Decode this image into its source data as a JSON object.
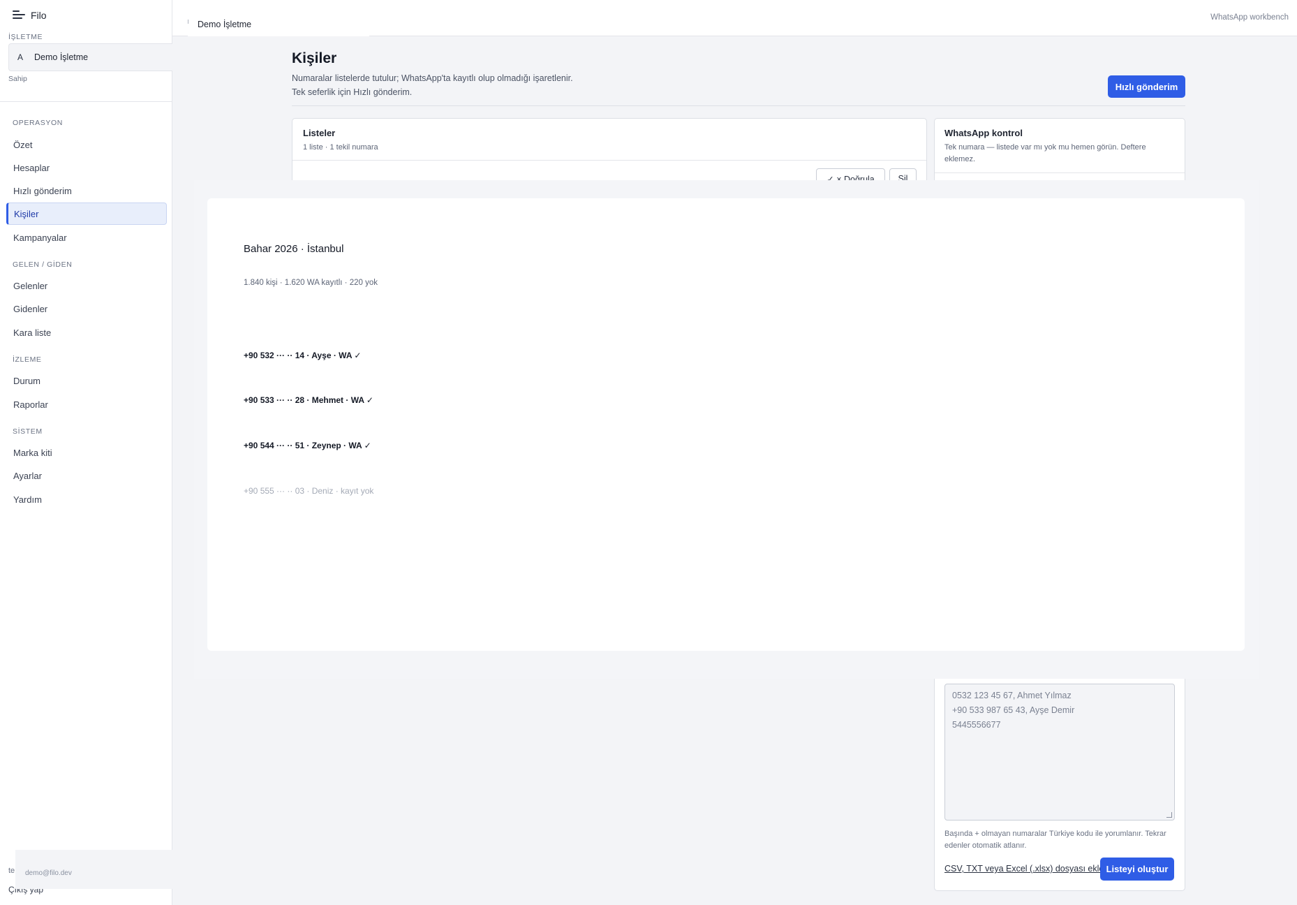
{
  "sidebar": {
    "brand": "Filo",
    "business_section": "İŞLETME",
    "business_avatar": "A",
    "business_name": "Demo İşletme",
    "role": "Sahip",
    "groups": [
      {
        "label": "OPERASYON",
        "items": [
          "Özet",
          "Hesaplar",
          "Hızlı gönderim",
          "Kişiler",
          "Kampanyalar"
        ]
      },
      {
        "label": "GELEN / GİDEN",
        "items": [
          "Gelenler",
          "Gidenler",
          "Kara liste"
        ]
      },
      {
        "label": "İZLEME",
        "items": [
          "Durum",
          "Raporlar"
        ]
      },
      {
        "label": "SİSTEM",
        "items": [
          "Marka kiti",
          "Ayarlar",
          "Yardım"
        ]
      }
    ],
    "active_item": "Kişiler",
    "user_email": "demo@filo.dev",
    "user_prefix": "te",
    "logout": "Çıkış yap"
  },
  "topbar": {
    "tab": "Demo İşletme",
    "workbench": "WhatsApp workbench"
  },
  "page": {
    "title": "Kişiler",
    "subtitle_1": "Numaralar listelerde tutulur; WhatsApp'ta kayıtlı olup olmadığı işaretlenir.",
    "subtitle_2": "Tek seferlik için Hızlı gönderim.",
    "quick_send": "Hızlı gönderim"
  },
  "lists_card": {
    "title": "Listeler",
    "meta": "1 liste · 1 tekil numara",
    "verify_button": "✓ × Doğrula",
    "delete_button": "Sil"
  },
  "wa_card": {
    "title": "WhatsApp kontrol",
    "meta": "Tek numara — listede var mı yok mu hemen görün. Deftere eklemez."
  },
  "modal": {
    "title": "Bahar 2026 · İstanbul",
    "stats": "1.840 kişi · 1.620 WA kayıtlı · 220 yok",
    "rows": [
      {
        "text": "+90 532 ··· ·· 14 · Ayşe · WA ✓",
        "registered": true
      },
      {
        "text": "+90 533 ··· ·· 28 · Mehmet · WA ✓",
        "registered": true
      },
      {
        "text": "+90 544 ··· ·· 51 · Zeynep · WA ✓",
        "registered": true
      },
      {
        "text": "+90 555 ··· ·· 03 · Deniz · kayıt yok",
        "registered": false
      }
    ]
  },
  "create_card": {
    "placeholder_lines": [
      "0532 123 45 67, Ahmet Yılmaz",
      "+90 533 987 65 43, Ayşe Demir",
      "5445556677"
    ],
    "hint": "Başında + olmayan numaralar Türkiye kodu ile yorumlanır. Tekrar edenler otomatik atlanır.",
    "file_link": "CSV, TXT veya Excel (.xlsx) dosyası ekle",
    "create_button": "Listeyi oluştur"
  },
  "colors": {
    "accent": "#2f5de6",
    "background": "#f3f4f7"
  }
}
